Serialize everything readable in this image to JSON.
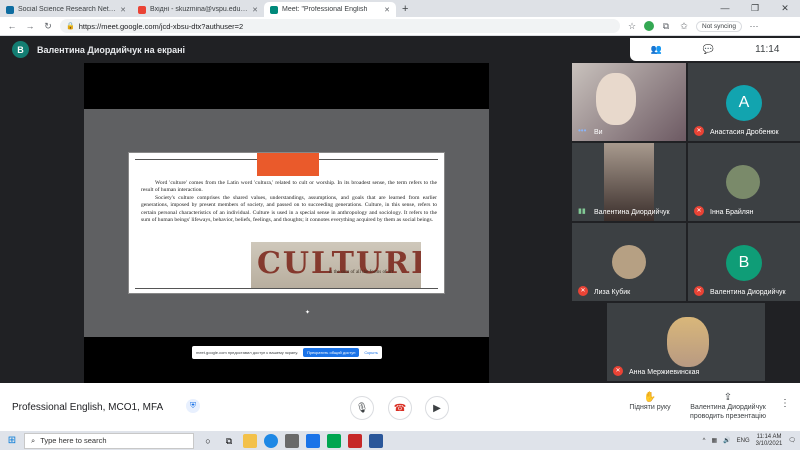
{
  "browser": {
    "tabs": [
      {
        "label": "Social Science Research Network",
        "color": "#0e6da1",
        "active": false
      },
      {
        "label": "Вхідні - skuzmina@vspu.edu.ua",
        "color": "#ea4335",
        "active": false
      },
      {
        "label": "Meet: \"Professional English",
        "color": "#00897b",
        "active": true
      }
    ],
    "url": "https://meet.google.com/jcd-xbsu-dtx?authuser=2",
    "sync_label": "Not syncing"
  },
  "meet": {
    "presenter_initial": "В",
    "presenting_label": "Валентина Диордийчук на екрані",
    "time": "11:14",
    "meeting_name": "Professional English, MCO1, MFA",
    "raise_hand_label": "Підняти руку",
    "presenting_action_label": "Валентина Диордийчук проводить презентацію",
    "share_banner": {
      "text": "meet.google.com предоставил доступ к вашему экрану.",
      "stop": "Прекратить общий доступ",
      "hide": "Скрыть"
    }
  },
  "slide": {
    "paragraph1": "Word 'culture' comes from the Latin word 'cultura,' related to cult or worship. In its broadest sense, the term refers to the result of human interaction.",
    "paragraph2": "Society's culture comprises the shared values, understandings, assumptions, and goals that are learned from earlier generations, imposed by present members of society, and passed on to succeeding generations. Culture, in this sense, refers to certain personal characteristics of an individual. Culture is used in a special sense in anthropology and sociology. It refers to the sum of human beings' lifeways, behavior, beliefs, feelings, and thoughts; it connotes everything acquired by them as social beings.",
    "image_word": "CULTURE",
    "image_caption": "is the sum of all the forms of art"
  },
  "participants": [
    {
      "name": "Ви"
    },
    {
      "name": "Анастасия Дробенюк",
      "initial": "А"
    },
    {
      "name": "Валентина Диордийчук"
    },
    {
      "name": "Інна Брайлян"
    },
    {
      "name": "Лиза Кубик"
    },
    {
      "name": "Валентина Диордийчук",
      "initial": "В"
    },
    {
      "name": "Анна Мержиевинская"
    }
  ],
  "taskbar": {
    "search_placeholder": "Type here to search",
    "tray_lang": "ENG",
    "time": "11:14 AM",
    "date": "3/10/2021"
  }
}
